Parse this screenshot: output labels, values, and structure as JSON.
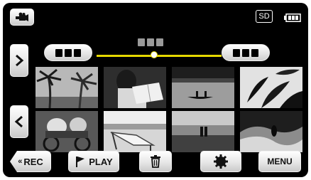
{
  "top_bar": {
    "mode_icon": "video-camera-icon",
    "media_badge": "SD",
    "battery_icon": "battery-icon"
  },
  "timeline": {
    "indicator_position": 0.46
  },
  "nav": {
    "next_icon": "chevron-right-icon",
    "prev_icon": "chevron-left-icon"
  },
  "thumbnails": [
    {
      "name": "palm-trees"
    },
    {
      "name": "person-reading"
    },
    {
      "name": "canoe-on-lake"
    },
    {
      "name": "tropical-leaves"
    },
    {
      "name": "cyclists"
    },
    {
      "name": "beach-lounge-chair"
    },
    {
      "name": "couple-on-beach"
    },
    {
      "name": "wave-surfer"
    }
  ],
  "bottom_bar": {
    "rec_label": "REC",
    "play_label": "PLAY",
    "trash_icon": "trash-icon",
    "settings_icon": "gear-icon",
    "menu_label": "MENU"
  },
  "colors": {
    "timeline_line": "#e6d800",
    "background": "#000000"
  }
}
